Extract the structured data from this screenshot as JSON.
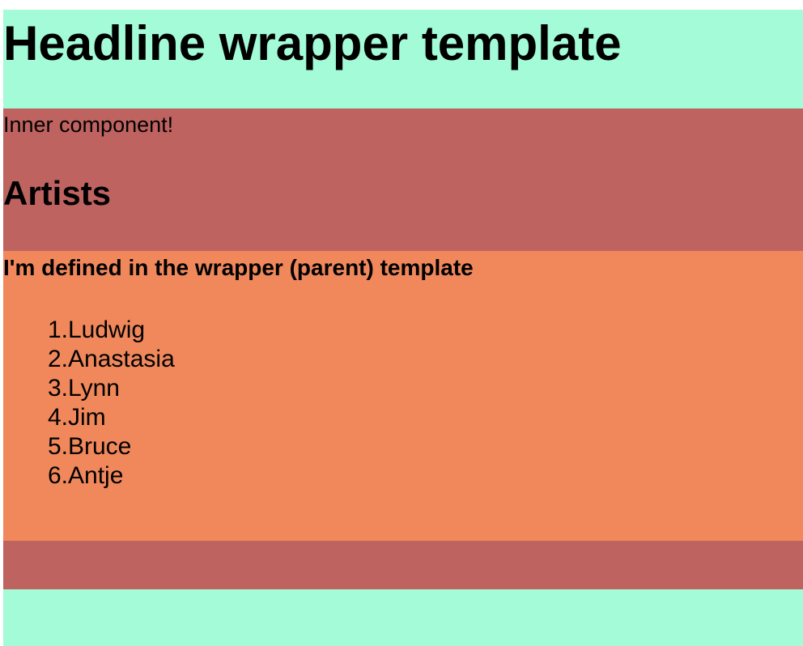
{
  "page": {
    "title": "Headline wrapper template"
  },
  "inner": {
    "label": "Inner component!",
    "heading": "Artists"
  },
  "parent_section": {
    "note": "I'm defined in the wrapper (parent) template",
    "artists": [
      {
        "num": "1. ",
        "name": "Ludwig"
      },
      {
        "num": "2. ",
        "name": "Anastasia"
      },
      {
        "num": "3. ",
        "name": "Lynn"
      },
      {
        "num": "4. ",
        "name": "Jim"
      },
      {
        "num": "5. ",
        "name": "Bruce"
      },
      {
        "num": "6. ",
        "name": "Antje"
      }
    ]
  },
  "colors": {
    "outer_background": "#a3fbd8",
    "middle_background": "#bf6361",
    "inner_background": "#f0885c"
  }
}
